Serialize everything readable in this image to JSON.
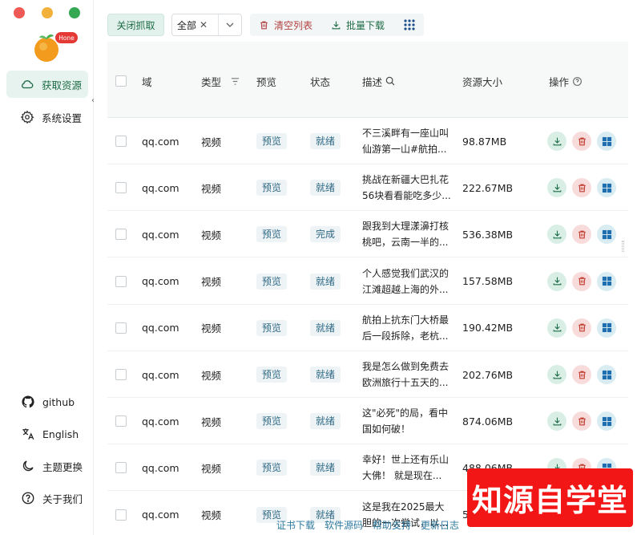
{
  "window": {
    "controls": [
      "close",
      "minimize",
      "maximize"
    ]
  },
  "logo": {
    "badge_text": "Hone"
  },
  "sidebar": {
    "items": [
      {
        "label": "获取资源",
        "icon": "cloud-icon",
        "active": true
      },
      {
        "label": "系统设置",
        "icon": "gear-icon",
        "active": false
      }
    ],
    "bottom_items": [
      {
        "label": "github",
        "icon": "github-icon"
      },
      {
        "label": "English",
        "icon": "translate-icon"
      },
      {
        "label": "主题更换",
        "icon": "moon-icon"
      },
      {
        "label": "关于我们",
        "icon": "help-icon"
      }
    ]
  },
  "toolbar": {
    "close_capture_label": "关闭抓取",
    "filter_selected": "全部",
    "clear_list_label": "清空列表",
    "batch_download_label": "批量下载"
  },
  "table": {
    "headers": {
      "domain": "域",
      "type": "类型",
      "preview": "预览",
      "status": "状态",
      "description": "描述",
      "size": "资源大小",
      "actions": "操作"
    },
    "rows": [
      {
        "domain": "qq.com",
        "type": "视频",
        "preview": "预览",
        "status": "就绪",
        "desc_line1": "不三溪畔有一座山叫",
        "desc_line2": "仙游第一山#航拍...",
        "size": "98.87MB"
      },
      {
        "domain": "qq.com",
        "type": "视频",
        "preview": "预览",
        "status": "就绪",
        "desc_line1": "挑战在新疆大巴扎花",
        "desc_line2": "56块看看能吃多少...",
        "size": "222.67MB"
      },
      {
        "domain": "qq.com",
        "type": "视频",
        "preview": "预览",
        "status": "完成",
        "desc_line1": "跟我到大理漾濞打核",
        "desc_line2": "桃吧，云南一半的...",
        "size": "536.38MB"
      },
      {
        "domain": "qq.com",
        "type": "视频",
        "preview": "预览",
        "status": "就绪",
        "desc_line1": "个人感觉我们武汉的",
        "desc_line2": "江滩超越上海的外...",
        "size": "157.58MB"
      },
      {
        "domain": "qq.com",
        "type": "视频",
        "preview": "预览",
        "status": "就绪",
        "desc_line1": "航拍上抗东门大桥最",
        "desc_line2": "后一段拆除，老杭...",
        "size": "190.42MB"
      },
      {
        "domain": "qq.com",
        "type": "视频",
        "preview": "预览",
        "status": "就绪",
        "desc_line1": "我是怎么做到免费去",
        "desc_line2": "欧洲旅行十五天的...",
        "size": "202.76MB"
      },
      {
        "domain": "qq.com",
        "type": "视频",
        "preview": "预览",
        "status": "就绪",
        "desc_line1": "这\"必死\"的局，看中",
        "desc_line2": "国如何破！",
        "size": "874.06MB"
      },
      {
        "domain": "qq.com",
        "type": "视频",
        "preview": "预览",
        "status": "就绪",
        "desc_line1": "幸好！世上还有乐山",
        "desc_line2": "大佛！ 就是现在...",
        "size": "488.06MB"
      },
      {
        "domain": "qq.com",
        "type": "视频",
        "preview": "预览",
        "status": "就绪",
        "desc_line1": "这是我在2025最大",
        "desc_line2": "胆的一次尝试，以...",
        "size": "5"
      }
    ]
  },
  "footer": {
    "links": [
      "证书下载",
      "软件源码",
      "帮助支持",
      "更新日志"
    ]
  },
  "watermark": {
    "text": "知源自学堂"
  },
  "colors": {
    "accent": "#1d6b46",
    "accent_bg": "#e7f3ee",
    "danger": "#b24040",
    "watermark": "#f31616"
  }
}
